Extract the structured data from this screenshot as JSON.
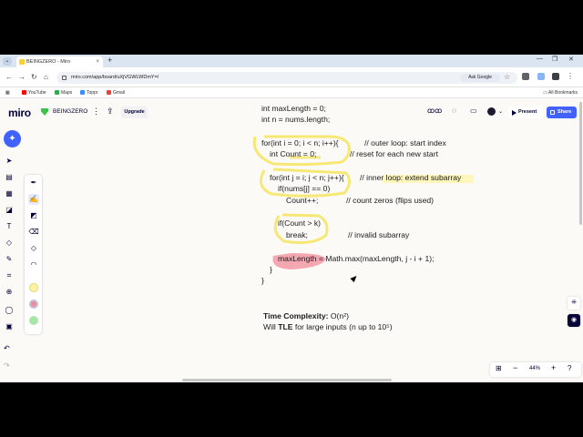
{
  "browser": {
    "tab_title": "BEINGZERO - Miro",
    "tab_close": "×",
    "new_tab": "+",
    "url": "miro.com/app/board/uXjVGWLWDmY=/",
    "ask_google": "Ask Google",
    "bookmarks": [
      {
        "label": "YouTube",
        "color": "#ff0000"
      },
      {
        "label": "Maps",
        "color": "#34a853"
      },
      {
        "label": "Toppr",
        "color": "#3f8cff"
      },
      {
        "label": "Gmail",
        "color": "#ea4335"
      }
    ],
    "all_bookmarks": "All Bookmarks"
  },
  "miro": {
    "logo": "miro",
    "board_name": "BEINGZERO",
    "upgrade_label": "Upgrade",
    "present_label": "Present",
    "share_label": "Share",
    "zoom": "44%",
    "accent_color": "#4262ff",
    "colors": [
      "#fff3a0",
      "#f28b98",
      "#a8e6a8"
    ]
  },
  "canvas": {
    "code_lines": [
      "int maxLength = 0;",
      "int n = nums.length;",
      "for(int i = 0; i < n; i++){",
      "int Count = 0;",
      "for(int j = i; j < n; j++){",
      "if(nums[j] == 0)",
      "Count++;",
      "if(Count > k)",
      "break;",
      "maxLength = Math.max(maxLength, j - i + 1);",
      "}",
      "}"
    ],
    "comments": [
      "// outer loop: start index",
      "// reset for each new start",
      "// inner loop: extend subarray",
      "// count zeros (flips used)",
      "// invalid subarray"
    ],
    "time_complexity_label": "Time Complexity:",
    "time_complexity_value": "O(n²)",
    "tle_prefix": "Will",
    "tle_bold": "TLE",
    "tle_suffix": "for large inputs (n up to 10⁵)"
  }
}
